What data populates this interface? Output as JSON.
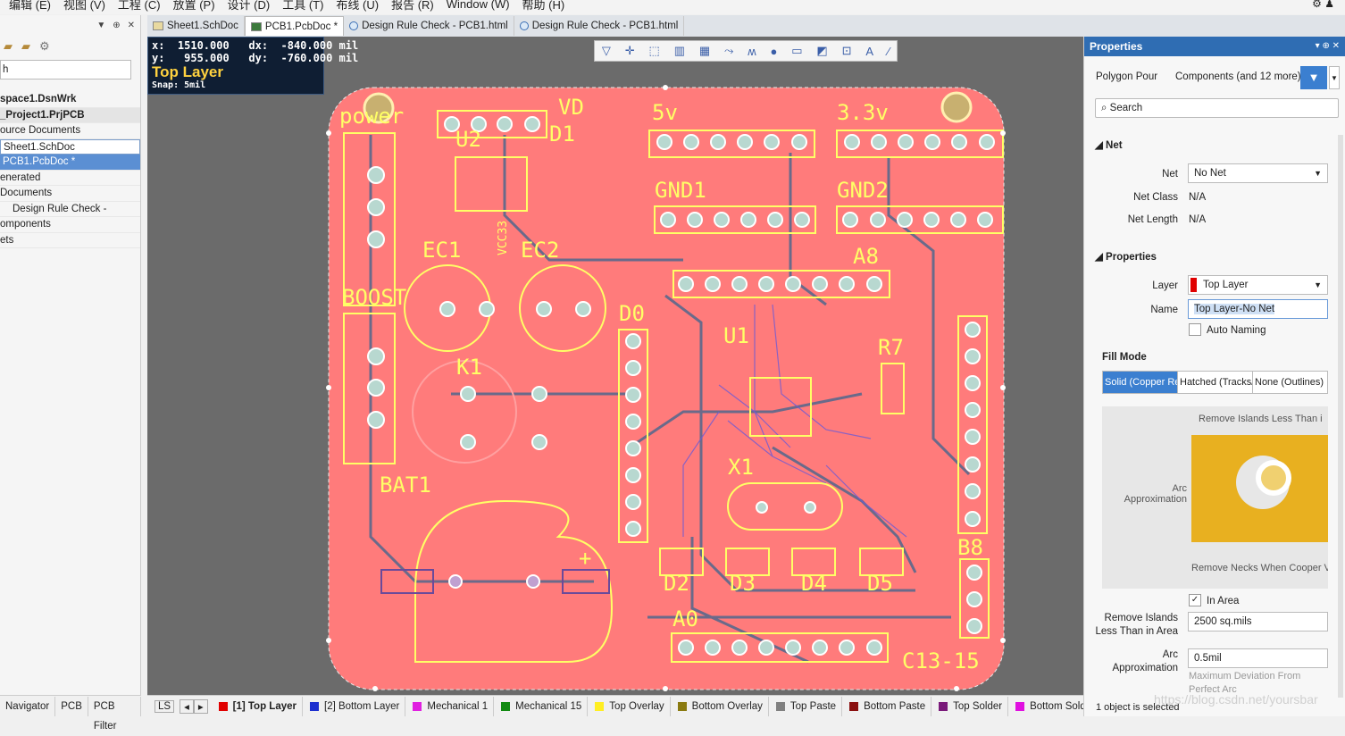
{
  "menubar": {
    "items": [
      "编辑 (E)",
      "视图 (V)",
      "工程 (C)",
      "放置 (P)",
      "设计 (D)",
      "工具 (T)",
      "布线 (U)",
      "报告 (R)",
      "Window (W)",
      "帮助 (H)"
    ],
    "right_icons": "⚙ ♟"
  },
  "tabs": [
    {
      "label": "Sheet1.SchDoc"
    },
    {
      "label": "PCB1.PcbDoc *"
    },
    {
      "label": "Design Rule Check - PCB1.html"
    },
    {
      "label": "Design Rule Check - PCB1.html"
    }
  ],
  "left": {
    "search_value": "h",
    "tree": [
      "space1.DsnWrk",
      "_Project1.PrjPCB",
      "ource Documents",
      "Sheet1.SchDoc",
      "PCB1.PcbDoc *",
      "enerated",
      "Documents",
      "Design Rule Check -",
      "omponents",
      "ets"
    ],
    "bottom_tabs": [
      "Navigator",
      "PCB",
      "PCB Filter"
    ]
  },
  "hud": {
    "line1": "x:  1510.000   dx:  -840.000 mil",
    "line2": "y:   955.000   dy:  -760.000 mil",
    "layer": "Top Layer",
    "snap": "Snap: 5mil"
  },
  "board": {
    "labels": [
      "power",
      "VD",
      "5v",
      "3.3v",
      "U2",
      "D1",
      "GND1",
      "GND2",
      "EC1",
      "EC2",
      "A8",
      "BOOST",
      "D0",
      "U1",
      "R7",
      "K1",
      "X1",
      "BAT1",
      "D2",
      "D3",
      "D4",
      "D5",
      "B8",
      "A0",
      "C13-15",
      "VCC33",
      "+"
    ],
    "colors": {
      "copper": "#ff7b7b",
      "background": "#6b6b6b",
      "overlay": "#ffff66",
      "track": "#6d5bd6",
      "pad": "#b8d8d0"
    }
  },
  "props": {
    "title": "Properties",
    "filter_left": "Polygon Pour",
    "filter_right": "Components (and 12 more)",
    "search_placeholder": "Search",
    "net_section": "Net",
    "net_label": "Net",
    "net_value": "No Net",
    "netclass_label": "Net Class",
    "netclass_value": "N/A",
    "netlength_label": "Net Length",
    "netlength_value": "N/A",
    "props_section": "Properties",
    "layer_label": "Layer",
    "layer_value": "Top Layer",
    "name_label": "Name",
    "name_value": "Top Layer-No Net",
    "autonaming": "Auto Naming",
    "fill_mode": "Fill Mode",
    "fill_opts": [
      "Solid (Copper Re",
      "Hatched (Tracks/",
      "None (Outlines)"
    ],
    "diagram_top": "Remove Islands Less Than i",
    "diagram_arc": "Arc\nApproximation",
    "diagram_bottom": "Remove Necks When Cooper V",
    "in_area": "In Area",
    "remove_islands_label": "Remove Islands Less Than in Area",
    "remove_islands_value": "2500 sq.mils",
    "arc_label": "Arc Approximation",
    "arc_value": "0.5mil",
    "arc_hint": "Maximum Deviation From Perfect Arc",
    "status": "1 object is selected"
  },
  "status": {
    "ls": "LS",
    "layers": [
      {
        "name": "[1] Top Layer",
        "color": "#e00000"
      },
      {
        "name": "[2] Bottom Layer",
        "color": "#1c2fcf"
      },
      {
        "name": "Mechanical 1",
        "color": "#e020e0"
      },
      {
        "name": "Mechanical 15",
        "color": "#118a11"
      },
      {
        "name": "Top Overlay",
        "color": "#ffee22"
      },
      {
        "name": "Bottom Overlay",
        "color": "#8a7a10"
      },
      {
        "name": "Top Paste",
        "color": "#808080"
      },
      {
        "name": "Bottom Paste",
        "color": "#8a1010"
      },
      {
        "name": "Top Solder",
        "color": "#7a1a7a"
      },
      {
        "name": "Bottom Solder",
        "color": "#e010e0"
      }
    ]
  },
  "watermark": "https://blog.csdn.net/yoursbar"
}
